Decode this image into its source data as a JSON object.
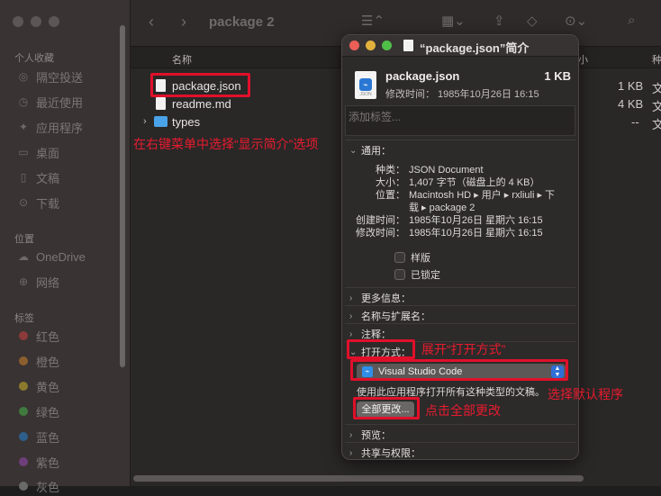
{
  "window": {
    "folder_title": "package 2"
  },
  "sidebar": {
    "favorites_header": "个人收藏",
    "favorites": [
      {
        "label": "隔空投送",
        "icon": "airdrop-icon"
      },
      {
        "label": "最近使用",
        "icon": "clock-icon"
      },
      {
        "label": "应用程序",
        "icon": "applications-icon"
      },
      {
        "label": "桌面",
        "icon": "desktop-icon"
      },
      {
        "label": "文稿",
        "icon": "document-icon"
      },
      {
        "label": "下载",
        "icon": "download-icon"
      }
    ],
    "locations_header": "位置",
    "locations": [
      {
        "label": "OneDrive",
        "icon": "cloud-icon"
      },
      {
        "label": "网络",
        "icon": "network-icon"
      }
    ],
    "tags_header": "标签",
    "tags": [
      {
        "label": "红色",
        "color": "#8c3a3a"
      },
      {
        "label": "橙色",
        "color": "#8c5e2e"
      },
      {
        "label": "黄色",
        "color": "#8c7a2e"
      },
      {
        "label": "绿色",
        "color": "#3f7a3f"
      },
      {
        "label": "蓝色",
        "color": "#2e5f8c"
      },
      {
        "label": "紫色",
        "color": "#6e3f7a"
      },
      {
        "label": "灰色",
        "color": "#6a6a6a"
      }
    ]
  },
  "list": {
    "col_name": "名称",
    "col_size_partial": "小",
    "col_kind_partial": "种",
    "rows": [
      {
        "name": "package.json",
        "size": "1 KB",
        "kind": "文"
      },
      {
        "name": "readme.md",
        "size": "4 KB",
        "kind": "文"
      },
      {
        "name": "types",
        "size": "--",
        "kind": "文"
      }
    ]
  },
  "info": {
    "title": "“package.json”简介",
    "file_name": "package.json",
    "file_size": "1 KB",
    "file_icon_type": "JSON",
    "modified_short": "修改时间：  1985年10月26日 16:15",
    "tags_placeholder": "添加标签...",
    "general_header": "通用：",
    "kind_label": "种类：",
    "kind_value": "JSON Document",
    "size_label": "大小：",
    "size_value": "1,407 字节（磁盘上的 4 KB）",
    "where_label": "位置：",
    "where_value_1": "Macintosh HD ▸ 用户 ▸ rxliuli ▸ 下",
    "where_value_2": "载 ▸ package 2",
    "created_label": "创建时间：",
    "created_value": "1985年10月26日 星期六 16:15",
    "modified_label": "修改时间：",
    "modified_value": "1985年10月26日 星期六 16:15",
    "stationery_label": "样版",
    "locked_label": "已锁定",
    "more_info": "更多信息：",
    "name_ext": "名称与扩展名：",
    "comments": "注释：",
    "open_with": "打开方式：",
    "app_name": "Visual Studio Code",
    "use_text": "使用此应用程序打开所有这种类型的文稿。",
    "change_all": "全部更改...",
    "preview": "预览：",
    "sharing": "共享与权限："
  },
  "annotations": {
    "step1": "在右键菜单中选择“显示简介”选项",
    "step2": "展开“打开方式”",
    "step3": "选择默认程序",
    "step4": "点击全部更改"
  }
}
